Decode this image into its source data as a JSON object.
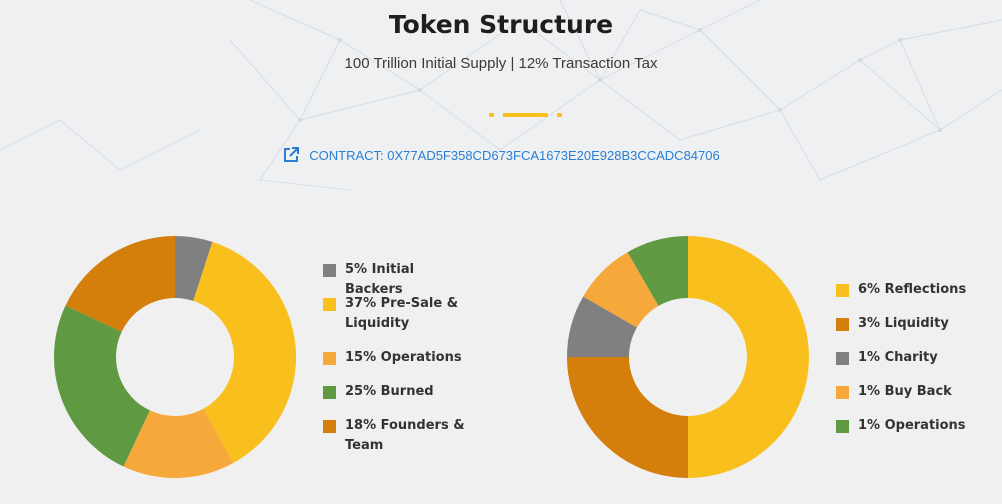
{
  "header": {
    "title": "Token Structure",
    "subtitle": "100 Trillion Initial Supply | 12% Transaction Tax",
    "accent_color": "#f9bf1d"
  },
  "contract": {
    "label": "CONTRACT: 0X77AD5F358CD673FCA1673E20E928B3CCADC84706",
    "icon": "external-link-icon",
    "color": "#2a7fd4"
  },
  "chart_data": [
    {
      "type": "pie",
      "categories": [
        "5% Initial Backers",
        "37% Pre-Sale & Liquidity",
        "15% Operations",
        "25% Burned",
        "18% Founders & Team"
      ],
      "values": [
        5,
        37,
        15,
        25,
        18
      ],
      "colors": [
        "#808080",
        "#f9bf1d",
        "#f6a83b",
        "#5f9a42",
        "#d47e0b"
      ],
      "donut": true,
      "legend_position": "right"
    },
    {
      "type": "pie",
      "categories": [
        "6% Reflections",
        "3% Liquidity",
        "1% Charity",
        "1% Buy Back",
        "1% Operations"
      ],
      "values": [
        6,
        3,
        1,
        1,
        1
      ],
      "colors": [
        "#f9bf1d",
        "#d47e0b",
        "#808080",
        "#f6a83b",
        "#5f9a42"
      ],
      "donut": true,
      "legend_position": "right"
    }
  ]
}
